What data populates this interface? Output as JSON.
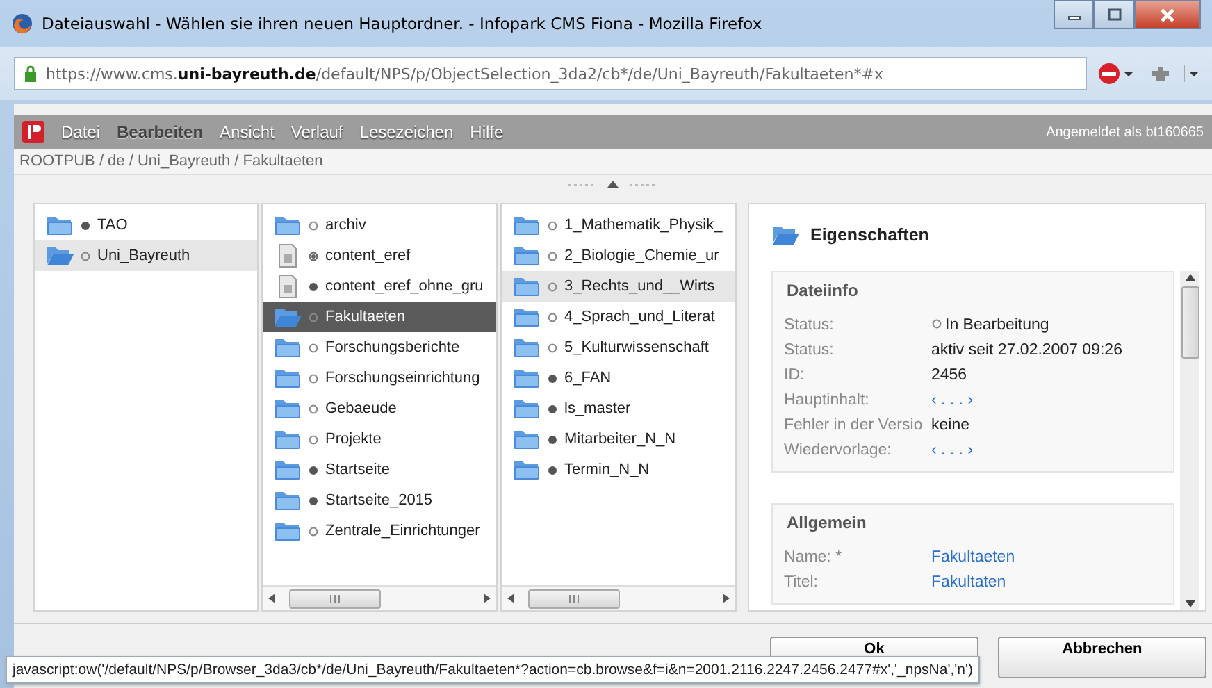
{
  "window": {
    "title": "Dateiauswahl - Wählen sie ihren neuen Hauptordner. - Infopark CMS Fiona - Mozilla Firefox"
  },
  "address_bar": {
    "url": "https://www.cms.**uni-bayreuth.de**/default/NPS/p/ObjectSelection_3da2/cb*/de/Uni_Bayreuth/Fakultaeten*#x"
  },
  "menu": {
    "items": [
      {
        "label": "Datei",
        "selected": false
      },
      {
        "label": "Bearbeiten",
        "selected": true
      },
      {
        "label": "Ansicht",
        "selected": false
      },
      {
        "label": "Verlauf",
        "selected": false
      },
      {
        "label": "Lesezeichen",
        "selected": false
      },
      {
        "label": "Hilfe",
        "selected": false
      }
    ],
    "user": "Angemeldet als bt160665"
  },
  "breadcrumb": "ROOTPUB / de / Uni_Bayreuth / Fakultaeten",
  "columns": [
    {
      "scrollbar": false,
      "items": [
        {
          "label": "TAO",
          "kind": "folder",
          "marker": {
            "kind": "filled"
          },
          "selected": false,
          "highlighted": false
        },
        {
          "label": "Uni_Bayreuth",
          "kind": "folder",
          "marker": {
            "kind": "open"
          },
          "selected": false,
          "highlighted": true
        }
      ]
    },
    {
      "scrollbar": true,
      "items": [
        {
          "label": "archiv",
          "kind": "folder",
          "marker": {
            "kind": "open"
          },
          "selected": false,
          "highlighted": false
        },
        {
          "label": "content_eref",
          "kind": "document",
          "marker": {
            "kind": "half"
          },
          "selected": false,
          "highlighted": false
        },
        {
          "label": "content_eref_ohne_gru",
          "kind": "document",
          "marker": {
            "kind": "filled"
          },
          "selected": false,
          "highlighted": false
        },
        {
          "label": "Fakultaeten",
          "kind": "folder",
          "marker": {
            "kind": "open"
          },
          "selected": true,
          "highlighted": false
        },
        {
          "label": "Forschungsberichte",
          "kind": "folder",
          "marker": {
            "kind": "open"
          },
          "selected": false,
          "highlighted": false
        },
        {
          "label": "Forschungseinrichtung",
          "kind": "folder",
          "marker": {
            "kind": "open"
          },
          "selected": false,
          "highlighted": false
        },
        {
          "label": "Gebaeude",
          "kind": "folder",
          "marker": {
            "kind": "open"
          },
          "selected": false,
          "highlighted": false
        },
        {
          "label": "Projekte",
          "kind": "folder",
          "marker": {
            "kind": "open"
          },
          "selected": false,
          "highlighted": false
        },
        {
          "label": "Startseite",
          "kind": "folder",
          "marker": {
            "kind": "filled"
          },
          "selected": false,
          "highlighted": false
        },
        {
          "label": "Startseite_2015",
          "kind": "folder",
          "marker": {
            "kind": "filled"
          },
          "selected": false,
          "highlighted": false
        },
        {
          "label": "Zentrale_Einrichtunger",
          "kind": "folder",
          "marker": {
            "kind": "open"
          },
          "selected": false,
          "highlighted": false
        }
      ]
    },
    {
      "scrollbar": true,
      "items": [
        {
          "label": "1_Mathematik_Physik_",
          "kind": "folder",
          "marker": {
            "kind": "open"
          },
          "selected": false,
          "highlighted": false
        },
        {
          "label": "2_Biologie_Chemie_ur",
          "kind": "folder",
          "marker": {
            "kind": "open"
          },
          "selected": false,
          "highlighted": false
        },
        {
          "label": "3_Rechts_und__Wirts",
          "kind": "folder",
          "marker": {
            "kind": "open"
          },
          "selected": false,
          "highlighted": true
        },
        {
          "label": "4_Sprach_und_Literat",
          "kind": "folder",
          "marker": {
            "kind": "open"
          },
          "selected": false,
          "highlighted": false
        },
        {
          "label": "5_Kulturwissenschaft",
          "kind": "folder",
          "marker": {
            "kind": "open"
          },
          "selected": false,
          "highlighted": false
        },
        {
          "label": "6_FAN",
          "kind": "folder",
          "marker": {
            "kind": "filled"
          },
          "selected": false,
          "highlighted": false
        },
        {
          "label": "ls_master",
          "kind": "folder",
          "marker": {
            "kind": "filled"
          },
          "selected": false,
          "highlighted": false
        },
        {
          "label": "Mitarbeiter_N_N",
          "kind": "folder",
          "marker": {
            "kind": "filled"
          },
          "selected": false,
          "highlighted": false
        },
        {
          "label": "Termin_N_N",
          "kind": "folder",
          "marker": {
            "kind": "filled"
          },
          "selected": false,
          "highlighted": false
        }
      ]
    }
  ],
  "properties": {
    "title": "Eigenschaften",
    "sections": [
      {
        "title": "Dateiinfo",
        "rows": [
          {
            "label": "Status:",
            "value": "In Bearbeitung",
            "kind": "status"
          },
          {
            "label": "Status:",
            "value": "aktiv seit 27.02.2007 09:26",
            "kind": "text"
          },
          {
            "label": "ID:",
            "value": "2456",
            "kind": "text"
          },
          {
            "label": "Hauptinhalt:",
            "value": "‹ . . . ›",
            "kind": "link"
          },
          {
            "label": "Fehler in der Versio",
            "value": "keine",
            "kind": "text"
          },
          {
            "label": "Wiedervorlage:",
            "value": "‹ . . . ›",
            "kind": "link"
          }
        ]
      },
      {
        "title": "Allgemein",
        "rows": [
          {
            "label": "Name: *",
            "value": "Fakultaeten",
            "kind": "link"
          },
          {
            "label": "Titel:",
            "value": "Fakultaten",
            "kind": "link"
          }
        ]
      }
    ]
  },
  "buttons": [
    "Ok",
    "Abbrechen"
  ],
  "status_text": "javascript:ow('/default/NPS/p/Browser_3da3/cb*/de/Uni_Bayreuth/Fakultaeten*?action=cb.browse&f=i&n=2001.2116.2247.2456.2477#x','_npsNa','n')"
}
